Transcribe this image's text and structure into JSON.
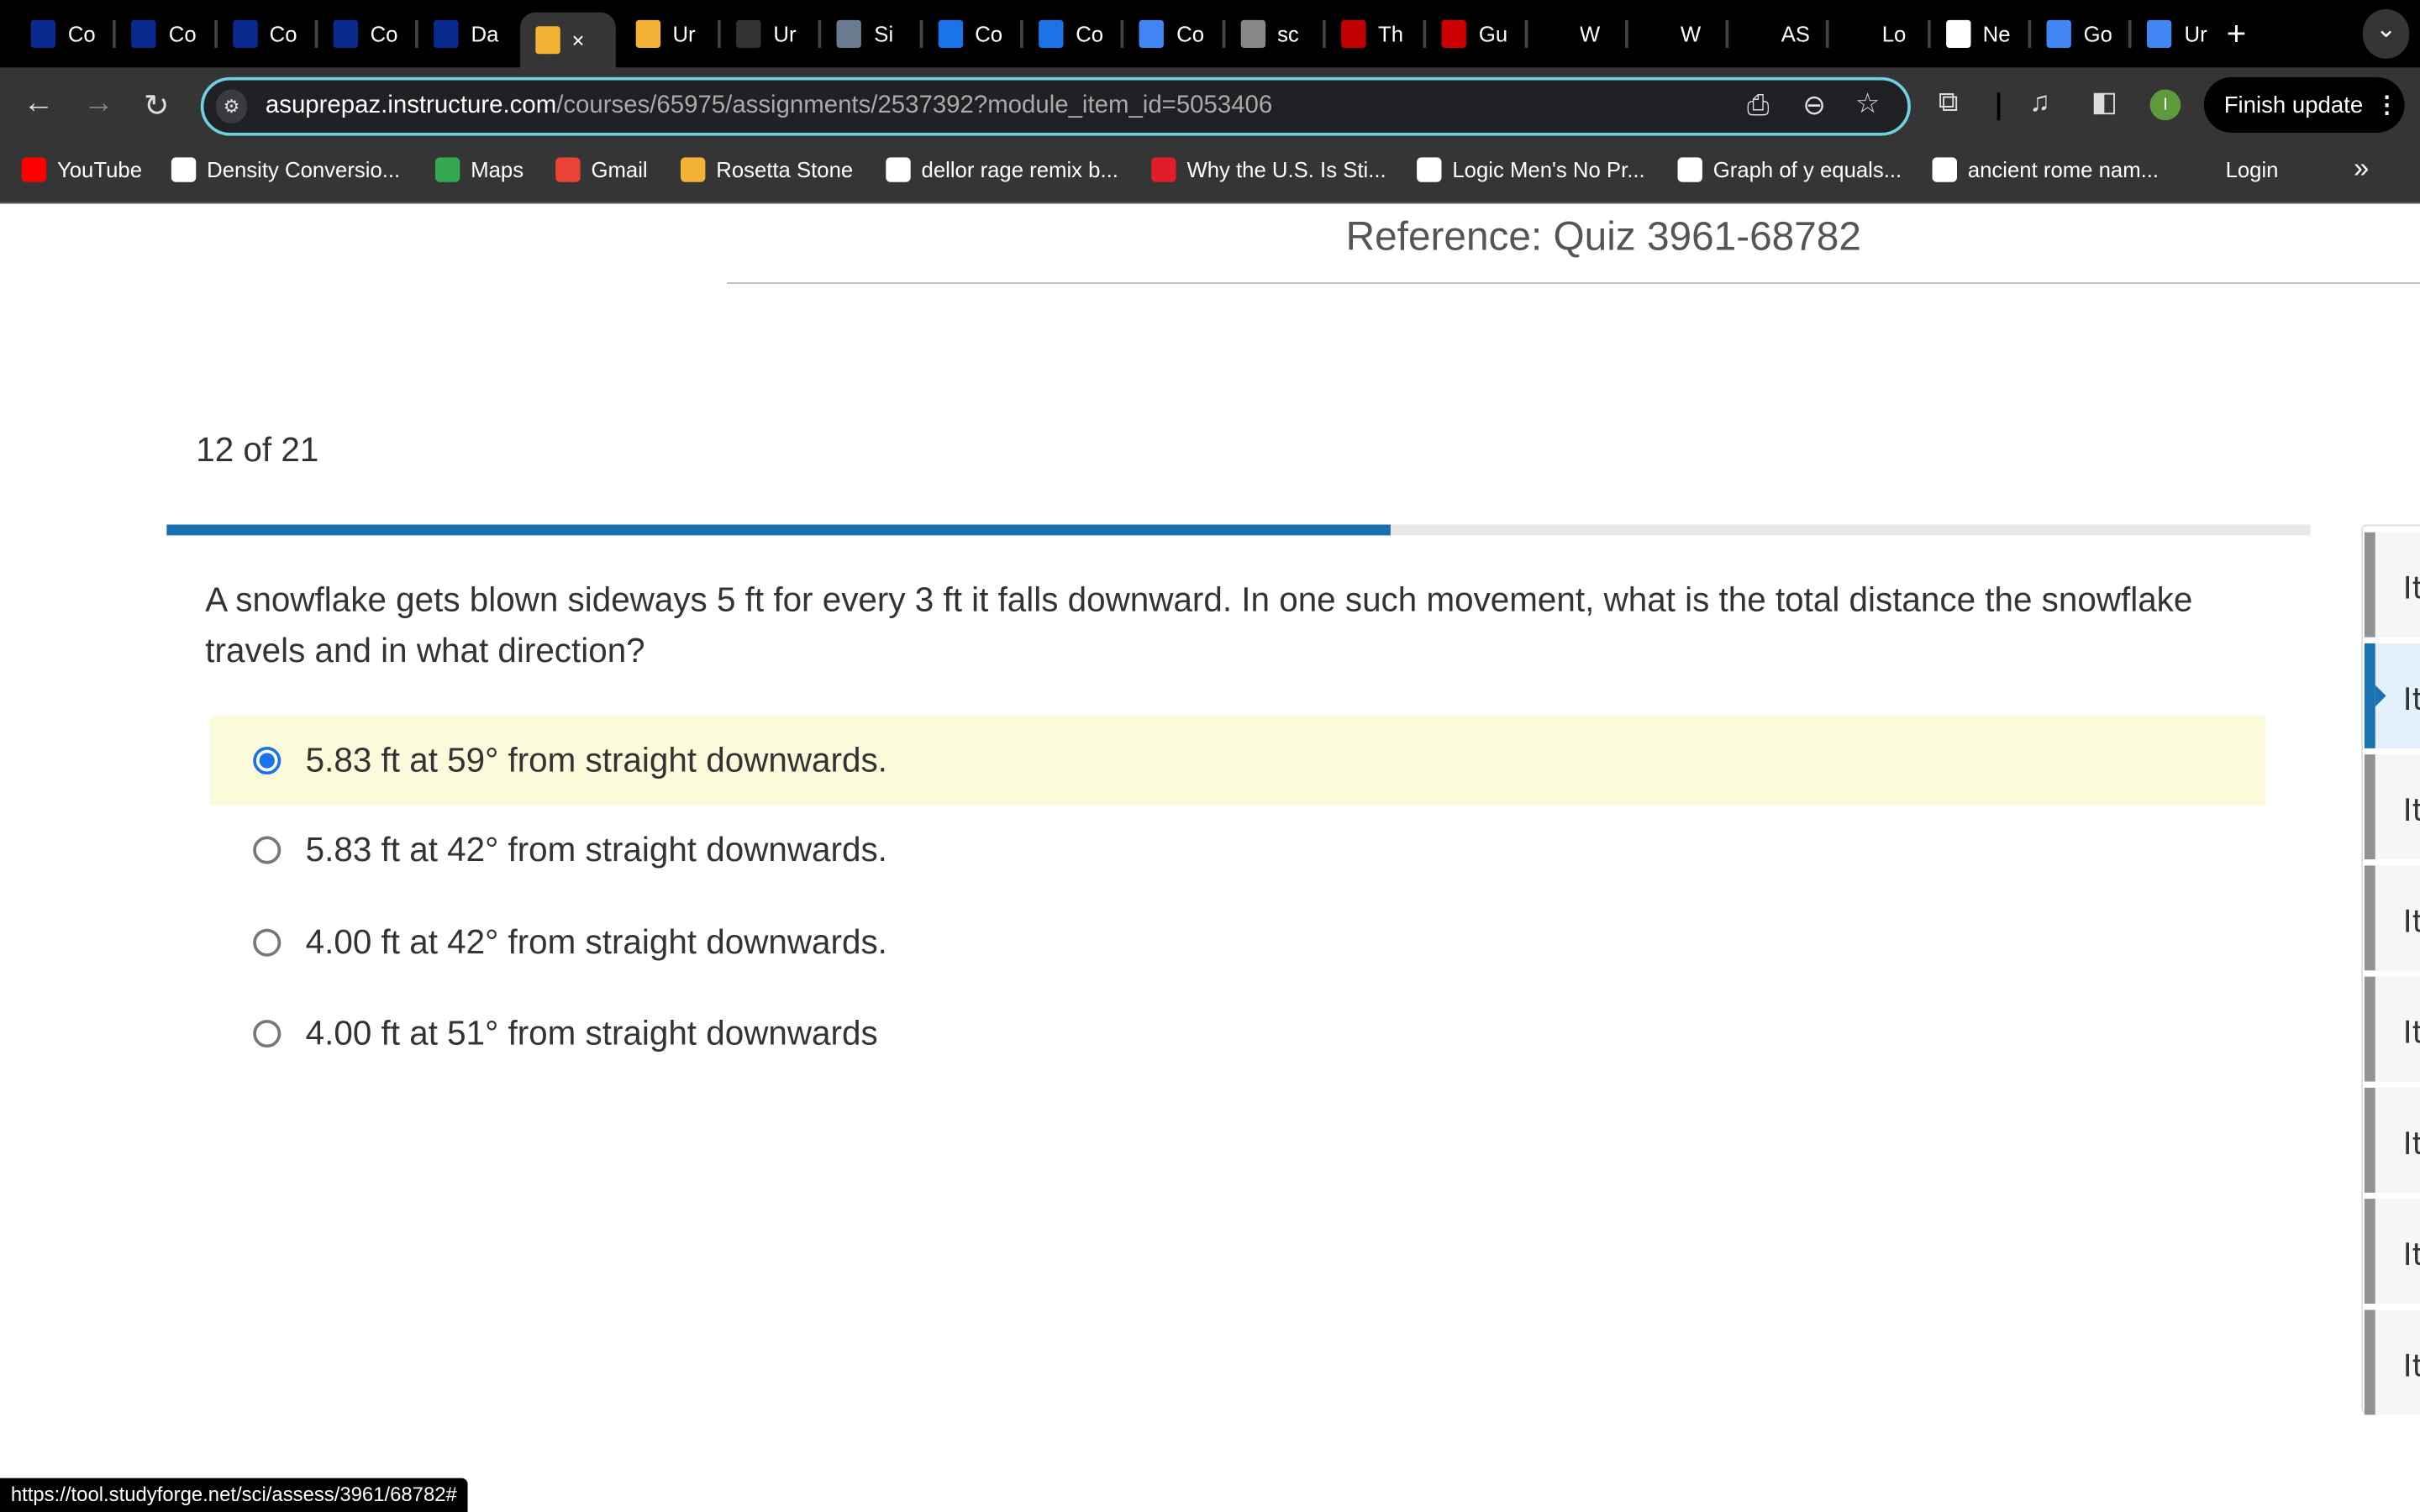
{
  "browser": {
    "tabs": [
      {
        "label": "Co",
        "icon": "star-shield-icon",
        "color": "#0a2a8f"
      },
      {
        "label": "Co",
        "icon": "star-shield-icon",
        "color": "#0a2a8f"
      },
      {
        "label": "Co",
        "icon": "star-shield-icon",
        "color": "#0a2a8f"
      },
      {
        "label": "Co",
        "icon": "star-shield-icon",
        "color": "#0a2a8f"
      },
      {
        "label": "Da",
        "icon": "star-shield-icon",
        "color": "#0a2a8f"
      },
      {
        "label": "×",
        "icon": "rosetta-icon",
        "color": "#f5b335",
        "active": true
      },
      {
        "label": "Ur",
        "icon": "rosetta-icon",
        "color": "#f5b335"
      },
      {
        "label": "Ur",
        "icon": "rainbow-icon",
        "color": "#333333"
      },
      {
        "label": "Si",
        "icon": "cubes-icon",
        "color": "#6a7a90"
      },
      {
        "label": "Co",
        "icon": "c-circle-icon",
        "color": "#1a73e8"
      },
      {
        "label": "Co",
        "icon": "c-circle-icon",
        "color": "#1a73e8"
      },
      {
        "label": "Co",
        "icon": "docs-icon",
        "color": "#4285f4"
      },
      {
        "label": "sc",
        "icon": "globe-icon",
        "color": "#888888"
      },
      {
        "label": "Th",
        "icon": "p-icon",
        "color": "#c00000"
      },
      {
        "label": "Gu",
        "icon": "cnn-icon",
        "color": "#cc0000"
      },
      {
        "label": "W",
        "icon": "blank-icon",
        "color": "#000000"
      },
      {
        "label": "W",
        "icon": "blank-icon",
        "color": "#000000"
      },
      {
        "label": "AS",
        "icon": "pitchfork-icon",
        "color": "#000000"
      },
      {
        "label": "Lo",
        "icon": "pitchfork-icon",
        "color": "#000000"
      },
      {
        "label": "Ne",
        "icon": "asu-icon",
        "color": "#ffffff"
      },
      {
        "label": "Go",
        "icon": "docs-icon",
        "color": "#4285f4"
      },
      {
        "label": "Ur",
        "icon": "docs-icon",
        "color": "#4285f4"
      }
    ],
    "new_tab": "+",
    "tab_search": "⌄",
    "url_host": "asuprepaz.instructure.com",
    "url_path": "/courses/65975/assignments/2537392?module_item_id=5053406",
    "profile_initial": "I",
    "finish_update": "Finish update",
    "bookmarks": [
      {
        "label": "YouTube",
        "icon": "youtube-icon",
        "color": "#ff0000"
      },
      {
        "label": "Density Conversio...",
        "icon": "sigma-icon",
        "color": "#ffffff"
      },
      {
        "label": "Maps",
        "icon": "maps-icon",
        "color": "#34a853"
      },
      {
        "label": "Gmail",
        "icon": "gmail-icon",
        "color": "#ea4335"
      },
      {
        "label": "Rosetta Stone",
        "icon": "rosetta-icon",
        "color": "#f5b335"
      },
      {
        "label": "dellor rage remix b...",
        "icon": "google-icon",
        "color": "#ffffff"
      },
      {
        "label": "Why the U.S. Is Sti...",
        "icon": "t-icon",
        "color": "#e11d2a"
      },
      {
        "label": "Logic Men's No Pr...",
        "icon": "globe-icon",
        "color": "#ffffff"
      },
      {
        "label": "Graph of y equals...",
        "icon": "globe-icon",
        "color": "#ffffff"
      },
      {
        "label": "ancient rome nam...",
        "icon": "google-icon",
        "color": "#ffffff"
      },
      {
        "label": "Login",
        "icon": "pitchfork-icon",
        "color": "#353535"
      }
    ],
    "bookmarks_more": "»",
    "status_url": "https://tool.studyforge.net/sci/assess/3961/68782#"
  },
  "quiz": {
    "reference": "Reference: Quiz 3961-68782",
    "counter": "12 of 21",
    "progress_percent": 57.1,
    "question": "A snowflake gets blown sideways 5 ft for every 3 ft it falls downward. In one such movement, what is the total distance the snowflake travels and in what direction?",
    "options": [
      {
        "text": "5.83 ft at 59° from straight downwards.",
        "selected": true
      },
      {
        "text": "5.83 ft at 42° from straight downwards.",
        "selected": false
      },
      {
        "text": "4.00 ft at 42° from straight downwards.",
        "selected": false
      },
      {
        "text": "4.00 ft at 51° from straight downwards",
        "selected": false
      }
    ],
    "side_items": [
      "It",
      "It",
      "It",
      "It",
      "It",
      "It",
      "It",
      "It"
    ],
    "current_side_item": 1,
    "accent": "#1a6fb0",
    "selected_bg": "#fbfbdb"
  }
}
